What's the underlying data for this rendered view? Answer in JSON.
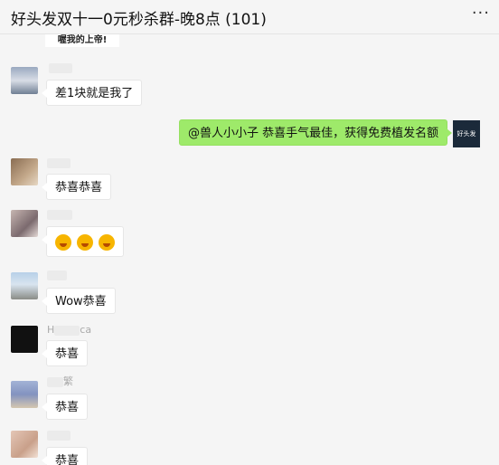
{
  "header": {
    "title": "好头发双十一0元秒杀群-晚8点 (101)",
    "more_label": "···"
  },
  "messages": [
    {
      "sender": "self",
      "text": "@兽人小小子   恭喜手气最佳，获得免费植发名额"
    },
    {
      "sender": "other",
      "text": "差1块就是我了"
    },
    {
      "sender": "other",
      "text": "恭喜恭喜"
    },
    {
      "sender": "other",
      "text": "",
      "emojis": [
        "grin-emoji",
        "grin-emoji",
        "grin-emoji"
      ]
    },
    {
      "sender": "other",
      "text": "Wow恭喜"
    },
    {
      "sender": "other",
      "text": "恭喜",
      "name_fragment_a": "H",
      "name_fragment_b": "ca"
    },
    {
      "sender": "other",
      "text": "恭喜",
      "name_fragment": "繁"
    },
    {
      "sender": "other",
      "text": "恭喜"
    }
  ],
  "top_sticker_text": "喔我的上帝!",
  "self_avatar_text": "好头发",
  "colors": {
    "self_bubble": "#9eea6a",
    "background": "#f5f5f5"
  }
}
